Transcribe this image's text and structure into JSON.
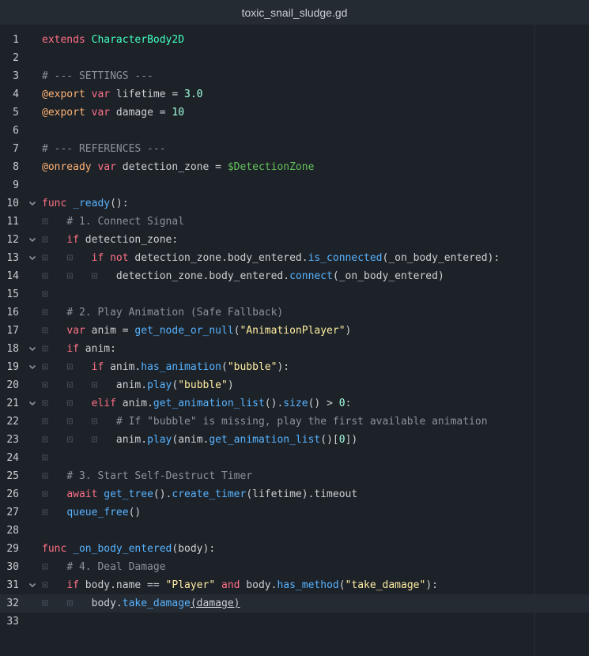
{
  "window": {
    "title": "toxic_snail_sludge.gd"
  },
  "editor": {
    "lines": [
      {
        "n": "1",
        "fold": false,
        "tokens": [
          [
            "kw",
            "extends"
          ],
          [
            "p",
            " "
          ],
          [
            "cls",
            "CharacterBody2D"
          ]
        ]
      },
      {
        "n": "2",
        "fold": false,
        "tokens": []
      },
      {
        "n": "3",
        "fold": false,
        "tokens": [
          [
            "cmt",
            "# --- SETTINGS ---"
          ]
        ]
      },
      {
        "n": "4",
        "fold": false,
        "tokens": [
          [
            "ann",
            "@export"
          ],
          [
            "p",
            " "
          ],
          [
            "kw",
            "var"
          ],
          [
            "p",
            " lifetime = "
          ],
          [
            "num",
            "3.0"
          ]
        ]
      },
      {
        "n": "5",
        "fold": false,
        "tokens": [
          [
            "ann",
            "@export"
          ],
          [
            "p",
            " "
          ],
          [
            "kw",
            "var"
          ],
          [
            "p",
            " damage = "
          ],
          [
            "num",
            "10"
          ]
        ]
      },
      {
        "n": "6",
        "fold": false,
        "tokens": []
      },
      {
        "n": "7",
        "fold": false,
        "tokens": [
          [
            "cmt",
            "# --- REFERENCES ---"
          ]
        ]
      },
      {
        "n": "8",
        "fold": false,
        "tokens": [
          [
            "ann",
            "@onready"
          ],
          [
            "p",
            " "
          ],
          [
            "kw",
            "var"
          ],
          [
            "p",
            " detection_zone = "
          ],
          [
            "nod",
            "$DetectionZone"
          ]
        ]
      },
      {
        "n": "9",
        "fold": false,
        "tokens": []
      },
      {
        "n": "10",
        "fold": true,
        "tokens": [
          [
            "kw",
            "func"
          ],
          [
            "p",
            " "
          ],
          [
            "fn",
            "_ready"
          ],
          [
            "p",
            "():"
          ]
        ]
      },
      {
        "n": "11",
        "fold": false,
        "tokens": [
          [
            "tab",
            "⊡"
          ],
          [
            "p",
            "   "
          ],
          [
            "cmt",
            "# 1. Connect Signal"
          ]
        ]
      },
      {
        "n": "12",
        "fold": true,
        "tokens": [
          [
            "tab",
            "⊡"
          ],
          [
            "p",
            "   "
          ],
          [
            "kw",
            "if"
          ],
          [
            "p",
            " detection_zone:"
          ]
        ]
      },
      {
        "n": "13",
        "fold": true,
        "tokens": [
          [
            "tab",
            "⊡"
          ],
          [
            "p",
            "   "
          ],
          [
            "tab",
            "⊡"
          ],
          [
            "p",
            "   "
          ],
          [
            "kw",
            "if not"
          ],
          [
            "p",
            " detection_zone.body_entered."
          ],
          [
            "fn",
            "is_connected"
          ],
          [
            "p",
            "(_on_body_entered):"
          ]
        ]
      },
      {
        "n": "14",
        "fold": false,
        "tokens": [
          [
            "tab",
            "⊡"
          ],
          [
            "p",
            "   "
          ],
          [
            "tab",
            "⊡"
          ],
          [
            "p",
            "   "
          ],
          [
            "tab",
            "⊡"
          ],
          [
            "p",
            "   detection_zone.body_entered."
          ],
          [
            "fn",
            "connect"
          ],
          [
            "p",
            "(_on_body_entered)"
          ]
        ]
      },
      {
        "n": "15",
        "fold": false,
        "tokens": [
          [
            "tab",
            "⊡"
          ]
        ]
      },
      {
        "n": "16",
        "fold": false,
        "tokens": [
          [
            "tab",
            "⊡"
          ],
          [
            "p",
            "   "
          ],
          [
            "cmt",
            "# 2. Play Animation (Safe Fallback)"
          ]
        ]
      },
      {
        "n": "17",
        "fold": false,
        "tokens": [
          [
            "tab",
            "⊡"
          ],
          [
            "p",
            "   "
          ],
          [
            "kw",
            "var"
          ],
          [
            "p",
            " anim = "
          ],
          [
            "fn",
            "get_node_or_null"
          ],
          [
            "p",
            "("
          ],
          [
            "str",
            "\"AnimationPlayer\""
          ],
          [
            "p",
            ")"
          ]
        ]
      },
      {
        "n": "18",
        "fold": true,
        "tokens": [
          [
            "tab",
            "⊡"
          ],
          [
            "p",
            "   "
          ],
          [
            "kw",
            "if"
          ],
          [
            "p",
            " anim:"
          ]
        ]
      },
      {
        "n": "19",
        "fold": true,
        "tokens": [
          [
            "tab",
            "⊡"
          ],
          [
            "p",
            "   "
          ],
          [
            "tab",
            "⊡"
          ],
          [
            "p",
            "   "
          ],
          [
            "kw",
            "if"
          ],
          [
            "p",
            " anim."
          ],
          [
            "fn",
            "has_animation"
          ],
          [
            "p",
            "("
          ],
          [
            "str",
            "\"bubble\""
          ],
          [
            "p",
            "):"
          ]
        ]
      },
      {
        "n": "20",
        "fold": false,
        "tokens": [
          [
            "tab",
            "⊡"
          ],
          [
            "p",
            "   "
          ],
          [
            "tab",
            "⊡"
          ],
          [
            "p",
            "   "
          ],
          [
            "tab",
            "⊡"
          ],
          [
            "p",
            "   anim."
          ],
          [
            "fn",
            "play"
          ],
          [
            "p",
            "("
          ],
          [
            "str",
            "\"bubble\""
          ],
          [
            "p",
            ")"
          ]
        ]
      },
      {
        "n": "21",
        "fold": true,
        "tokens": [
          [
            "tab",
            "⊡"
          ],
          [
            "p",
            "   "
          ],
          [
            "tab",
            "⊡"
          ],
          [
            "p",
            "   "
          ],
          [
            "kw",
            "elif"
          ],
          [
            "p",
            " anim."
          ],
          [
            "fn",
            "get_animation_list"
          ],
          [
            "p",
            "()."
          ],
          [
            "fn",
            "size"
          ],
          [
            "p",
            "() > "
          ],
          [
            "num",
            "0"
          ],
          [
            "p",
            ":"
          ]
        ]
      },
      {
        "n": "22",
        "fold": false,
        "tokens": [
          [
            "tab",
            "⊡"
          ],
          [
            "p",
            "   "
          ],
          [
            "tab",
            "⊡"
          ],
          [
            "p",
            "   "
          ],
          [
            "tab",
            "⊡"
          ],
          [
            "p",
            "   "
          ],
          [
            "cmt",
            "# If \"bubble\" is missing, play the first available animation"
          ]
        ]
      },
      {
        "n": "23",
        "fold": false,
        "tokens": [
          [
            "tab",
            "⊡"
          ],
          [
            "p",
            "   "
          ],
          [
            "tab",
            "⊡"
          ],
          [
            "p",
            "   "
          ],
          [
            "tab",
            "⊡"
          ],
          [
            "p",
            "   anim."
          ],
          [
            "fn",
            "play"
          ],
          [
            "p",
            "(anim."
          ],
          [
            "fn",
            "get_animation_list"
          ],
          [
            "p",
            "()["
          ],
          [
            "num",
            "0"
          ],
          [
            "p",
            "])"
          ]
        ]
      },
      {
        "n": "24",
        "fold": false,
        "tokens": [
          [
            "tab",
            "⊡"
          ]
        ]
      },
      {
        "n": "25",
        "fold": false,
        "tokens": [
          [
            "tab",
            "⊡"
          ],
          [
            "p",
            "   "
          ],
          [
            "cmt",
            "# 3. Start Self-Destruct Timer"
          ]
        ]
      },
      {
        "n": "26",
        "fold": false,
        "tokens": [
          [
            "tab",
            "⊡"
          ],
          [
            "p",
            "   "
          ],
          [
            "kw",
            "await"
          ],
          [
            "p",
            " "
          ],
          [
            "fn",
            "get_tree"
          ],
          [
            "p",
            "()."
          ],
          [
            "fn",
            "create_timer"
          ],
          [
            "p",
            "(lifetime).timeout"
          ]
        ]
      },
      {
        "n": "27",
        "fold": false,
        "tokens": [
          [
            "tab",
            "⊡"
          ],
          [
            "p",
            "   "
          ],
          [
            "fn",
            "queue_free"
          ],
          [
            "p",
            "()"
          ]
        ]
      },
      {
        "n": "28",
        "fold": false,
        "tokens": []
      },
      {
        "n": "29",
        "fold": false,
        "tokens": [
          [
            "kw",
            "func"
          ],
          [
            "p",
            " "
          ],
          [
            "fn",
            "_on_body_entered"
          ],
          [
            "p",
            "(body):"
          ]
        ]
      },
      {
        "n": "30",
        "fold": false,
        "tokens": [
          [
            "tab",
            "⊡"
          ],
          [
            "p",
            "   "
          ],
          [
            "cmt",
            "# 4. Deal Damage"
          ]
        ]
      },
      {
        "n": "31",
        "fold": true,
        "tokens": [
          [
            "tab",
            "⊡"
          ],
          [
            "p",
            "   "
          ],
          [
            "kw",
            "if"
          ],
          [
            "p",
            " body.name == "
          ],
          [
            "str",
            "\"Player\""
          ],
          [
            "p",
            " "
          ],
          [
            "kw",
            "and"
          ],
          [
            "p",
            " body."
          ],
          [
            "fn",
            "has_method"
          ],
          [
            "p",
            "("
          ],
          [
            "str",
            "\"take_damage\""
          ],
          [
            "p",
            "):"
          ]
        ]
      },
      {
        "n": "32",
        "fold": false,
        "current": true,
        "tokens": [
          [
            "tab",
            "⊡"
          ],
          [
            "p",
            "   "
          ],
          [
            "tab",
            "⊡"
          ],
          [
            "p",
            "   body."
          ],
          [
            "fn",
            "take_damage"
          ],
          [
            "cur",
            "(damage)"
          ]
        ]
      },
      {
        "n": "33",
        "fold": false,
        "tokens": []
      }
    ]
  },
  "icons": {
    "fold": "chevron-down-icon",
    "tab": "tab-indent-icon"
  },
  "colors": {
    "background": "#1d2229",
    "keyword": "#ff7085",
    "class": "#42ffc2",
    "number": "#a1ffe0",
    "comment": "#8c9299",
    "annotation": "#ffb373",
    "node_path": "#63c259",
    "function": "#57b3ff",
    "string": "#ffeda1"
  }
}
